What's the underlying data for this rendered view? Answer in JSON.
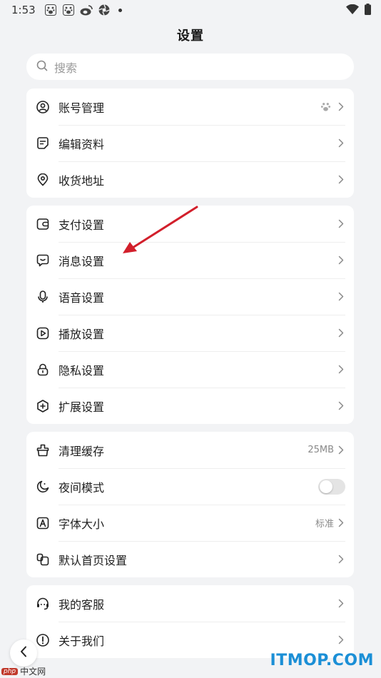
{
  "status_bar": {
    "time": "1:53",
    "icons": [
      "paw-icon",
      "paw-icon",
      "weibo-icon",
      "aperture-icon"
    ],
    "right_icons": [
      "wifi-icon",
      "battery-icon"
    ]
  },
  "header": {
    "title": "设置"
  },
  "search": {
    "placeholder": "搜索"
  },
  "groups": [
    {
      "items": [
        {
          "label": "账号管理",
          "icon": "user-circle-icon",
          "badge_icon": "paw-icon"
        },
        {
          "label": "编辑资料",
          "icon": "edit-note-icon"
        },
        {
          "label": "收货地址",
          "icon": "location-pin-icon"
        }
      ]
    },
    {
      "items": [
        {
          "label": "支付设置",
          "icon": "wallet-icon"
        },
        {
          "label": "消息设置",
          "icon": "message-icon"
        },
        {
          "label": "语音设置",
          "icon": "microphone-icon"
        },
        {
          "label": "播放设置",
          "icon": "play-icon"
        },
        {
          "label": "隐私设置",
          "icon": "lock-icon"
        },
        {
          "label": "扩展设置",
          "icon": "plus-hexagon-icon"
        }
      ]
    },
    {
      "items": [
        {
          "label": "清理缓存",
          "icon": "broom-icon",
          "value": "25MB"
        },
        {
          "label": "夜间模式",
          "icon": "moon-icon",
          "toggle": false
        },
        {
          "label": "字体大小",
          "icon": "font-size-icon",
          "value": "标准"
        },
        {
          "label": "默认首页设置",
          "icon": "home-layout-icon"
        }
      ]
    },
    {
      "items": [
        {
          "label": "我的客服",
          "icon": "headset-icon"
        },
        {
          "label": "关于我们",
          "icon": "info-icon"
        }
      ]
    }
  ],
  "watermarks": {
    "left_badge": "php",
    "left_text": "中文网",
    "right": "ITMOP.COM"
  },
  "annotation_color": "#d21f2b"
}
